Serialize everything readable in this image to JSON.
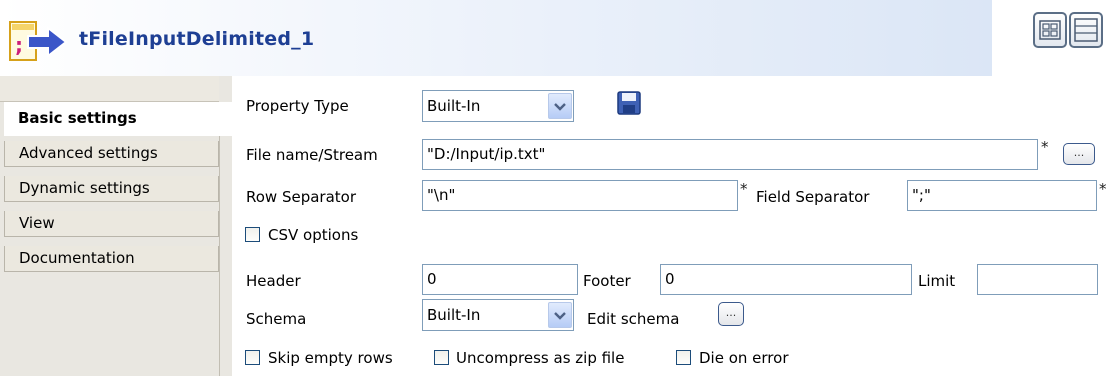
{
  "header": {
    "title": "tFileInputDelimited_1",
    "view_buttons": [
      "grid-view-icon",
      "list-view-icon"
    ]
  },
  "sidebar": {
    "items": [
      {
        "label": "Basic settings",
        "active": true
      },
      {
        "label": "Advanced settings",
        "active": false
      },
      {
        "label": "Dynamic settings",
        "active": false
      },
      {
        "label": "View",
        "active": false
      },
      {
        "label": "Documentation",
        "active": false
      }
    ]
  },
  "form": {
    "property_type": {
      "label": "Property Type",
      "value": "Built-In"
    },
    "file_name": {
      "label": "File name/Stream",
      "value": "\"D:/Input/ip.txt\"",
      "required_mark": "*",
      "browse": "..."
    },
    "row_separator": {
      "label": "Row Separator",
      "value": "\"\\n\"",
      "required_mark": "*"
    },
    "field_separator": {
      "label": "Field Separator",
      "value": "\";\"",
      "required_mark": "*"
    },
    "csv_options": {
      "label": "CSV options",
      "checked": false
    },
    "header": {
      "label": "Header",
      "value": "0"
    },
    "footer": {
      "label": "Footer",
      "value": "0"
    },
    "limit": {
      "label": "Limit",
      "value": ""
    },
    "schema": {
      "label": "Schema",
      "value": "Built-In"
    },
    "edit_schema": {
      "label": "Edit schema",
      "button": "..."
    },
    "skip_empty_rows": {
      "label": "Skip empty rows",
      "checked": false
    },
    "uncompress_zip": {
      "label": "Uncompress as zip file",
      "checked": false
    },
    "die_on_error": {
      "label": "Die on error",
      "checked": false
    }
  },
  "colors": {
    "title": "#1e3f94",
    "field_border": "#7f9db9",
    "sidebar_bg": "#e9e7e1"
  }
}
